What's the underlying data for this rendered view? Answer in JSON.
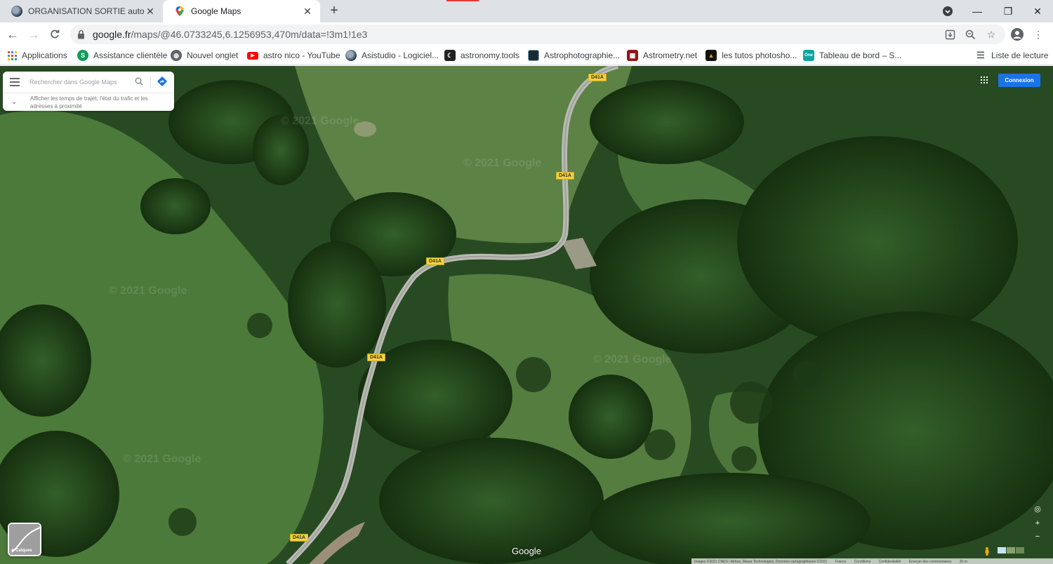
{
  "browser": {
    "tabs": [
      {
        "title": "ORGANISATION SORTIE autour d",
        "active": false
      },
      {
        "title": "Google Maps",
        "active": true
      }
    ],
    "new_tab": "+",
    "url_host": "google.fr",
    "url_rest": "/maps/@46.0733245,6.1256953,470m/data=!3m1!1e3"
  },
  "bookmarks": [
    {
      "label": "Applications",
      "icon": "apps-grid-icon"
    },
    {
      "label": "Assistance clientèle",
      "icon": "s-icon"
    },
    {
      "label": "Nouvel onglet",
      "icon": "globe-icon"
    },
    {
      "label": "astro nico - YouTube",
      "icon": "youtube-icon"
    },
    {
      "label": "Asistudio - Logiciel...",
      "icon": "asistudio-icon"
    },
    {
      "label": "astronomy.tools",
      "icon": "moon-icon"
    },
    {
      "label": "Astrophotographie...",
      "icon": "astro-icon"
    },
    {
      "label": "Astrometry.net",
      "icon": "astrometry-icon"
    },
    {
      "label": "les tutos photosho...",
      "icon": "tutos-icon"
    },
    {
      "label": "Tableau de bord – S...",
      "icon": "one-icon"
    }
  ],
  "reading_list": "Liste de lecture",
  "maps": {
    "search_placeholder": "Rechercher dans Google Maps",
    "hint": "Afficher les temps de trajet, l'état du trafic et les adresses à proximité",
    "signin": "Connexion",
    "layers": "Calques",
    "logo": "Google",
    "watermark": "© 2021 Google",
    "road_label": "D41A",
    "footer": [
      "Images ©2021 CNES / Airbus, Maxar Technologies, Données cartographiques ©2021",
      "France",
      "Conditions",
      "Confidentialité",
      "Envoyer des commentaires",
      "20 m"
    ]
  }
}
